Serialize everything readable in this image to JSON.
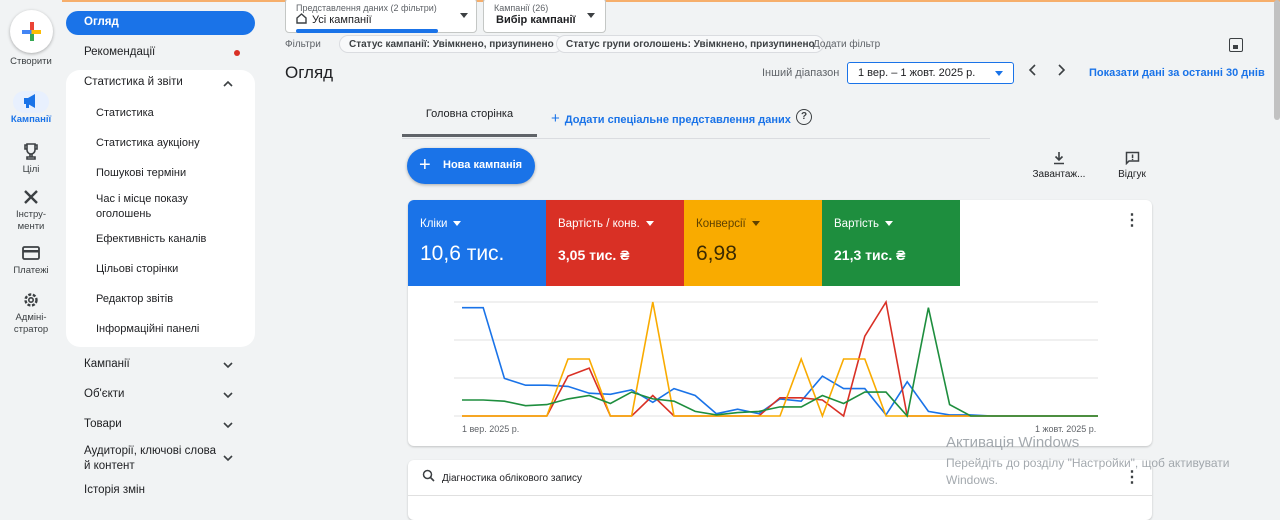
{
  "rail": {
    "create_label": "Створити",
    "items": [
      {
        "label": "Кампанії",
        "icon": "megaphone-icon"
      },
      {
        "label": "Цілі",
        "icon": "trophy-icon"
      },
      {
        "label": "Інстру-\nменти",
        "icon": "tools-icon"
      },
      {
        "label": "Платежі",
        "icon": "card-icon"
      },
      {
        "label": "Адміні-\nстратор",
        "icon": "gear-icon"
      }
    ]
  },
  "nav": {
    "overview": "Огляд",
    "recommendations": "Рекомендації",
    "stats_reports": "Статистика й звіти",
    "sub_items": [
      "Статистика",
      "Статистика аукціону",
      "Пошукові терміни",
      "Час і місце показу оголошень",
      "Ефективність каналів",
      "Цільові сторінки",
      "Редактор звітів",
      "Інформаційні панелі"
    ],
    "groups": [
      "Кампанії",
      "Об'єкти",
      "Товари",
      "Аудиторії, ключові слова й контент"
    ],
    "history": "Історія змін"
  },
  "topbar": {
    "view_small": "Представлення даних (2 фільтри)",
    "view_value": "Усі кампанії",
    "camp_small": "Кампанії (26)",
    "camp_value": "Вибір кампанії",
    "filters_label": "Фільтри",
    "chip1": "Статус кампанії: Увімкнено, призупинено",
    "chip2": "Статус групи оголошень: Увімкнено, призупинено",
    "add_filter": "Додати фільтр"
  },
  "main": {
    "title": "Огляд",
    "range_label": "Інший діапазон",
    "range_value": "1 вер. – 1 жовт. 2025 р.",
    "last30": "Показати дані за останні 30 днів",
    "tab_home": "Головна сторінка",
    "tab_add": "Додати спеціальне представлення даних",
    "new_campaign": "Нова кампанія",
    "download": "Завантаж...",
    "feedback": "Відгук",
    "diagnostics": "Діагностика облікового запису"
  },
  "metrics": [
    {
      "label": "Кліки",
      "value": "10,6 тис.",
      "color": "#1a73e8"
    },
    {
      "label": "Вартість / конв.",
      "value": "3,05 тис. ₴",
      "color": "#d93025"
    },
    {
      "label": "Конверсії",
      "value": "6,98",
      "color": "#f9ab00"
    },
    {
      "label": "Вартість",
      "value": "21,3 тис. ₴",
      "color": "#1e8e3e"
    }
  ],
  "chart_data": {
    "type": "line",
    "x_start_label": "1 вер. 2025 р.",
    "x_end_label": "1 жовт. 2025 р.",
    "series": [
      {
        "name": "Кліки",
        "color": "#1a73e8",
        "values": [
          95,
          95,
          33,
          27,
          27,
          26,
          20,
          19,
          23,
          12,
          24,
          18,
          2,
          6,
          2,
          15,
          13,
          35,
          24,
          24,
          1,
          30,
          4,
          1,
          1,
          0,
          0,
          0,
          0,
          0,
          0
        ]
      },
      {
        "name": "Вартість / конв.",
        "color": "#d93025",
        "values": [
          0,
          0,
          0,
          0,
          0,
          35,
          42,
          0,
          0,
          18,
          0,
          0,
          0,
          0,
          0,
          16,
          16,
          14,
          0,
          70,
          100,
          0,
          0,
          0,
          0,
          0,
          0,
          0,
          0,
          0,
          0
        ]
      },
      {
        "name": "Конверсії",
        "color": "#f9ab00",
        "values": [
          0,
          0,
          0,
          0,
          0,
          50,
          50,
          0,
          0,
          100,
          0,
          0,
          0,
          0,
          0,
          0,
          50,
          0,
          50,
          50,
          0,
          0,
          0,
          0,
          0,
          0,
          0,
          0,
          0,
          0,
          0
        ]
      },
      {
        "name": "Вартість",
        "color": "#1e8e3e",
        "values": [
          14,
          14,
          13,
          9,
          10,
          15,
          18,
          11,
          21,
          15,
          13,
          4,
          1,
          3,
          4,
          8,
          8,
          18,
          11,
          21,
          21,
          0,
          95,
          10,
          0,
          0,
          0,
          0,
          0,
          0,
          0
        ]
      }
    ],
    "ylim": [
      0,
      100
    ],
    "grid": true
  },
  "watermark": {
    "title": "Активація Windows",
    "line1": "Перейдіть до розділу \"Настройки\", щоб активувати",
    "line2": "Windows."
  }
}
